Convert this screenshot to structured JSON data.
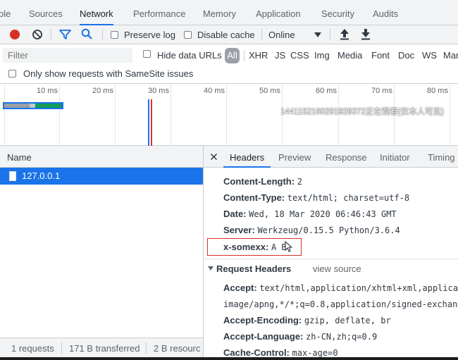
{
  "tabs": [
    {
      "label": "ble"
    },
    {
      "label": "Sources"
    },
    {
      "label": "Network"
    },
    {
      "label": "Performance"
    },
    {
      "label": "Memory"
    },
    {
      "label": "Application"
    },
    {
      "label": "Security"
    },
    {
      "label": "Audits"
    }
  ],
  "toolbar": {
    "preserve_log": "Preserve log",
    "disable_cache": "Disable cache",
    "throttle": "Online"
  },
  "filter": {
    "placeholder": "Filter",
    "hide_data_urls": "Hide data URLs",
    "types": [
      "All",
      "XHR",
      "JS",
      "CSS",
      "Img",
      "Media",
      "Font",
      "Doc",
      "WS",
      "Mar"
    ]
  },
  "samesite": "Only show requests with SameSite issues",
  "timeline": {
    "ticks": [
      "10 ms",
      "20 ms",
      "30 ms",
      "40 ms",
      "50 ms",
      "60 ms",
      "70 ms",
      "80 ms"
    ],
    "watermark": "1441152160291928372正在观看(仅本人可见)"
  },
  "colors": {
    "accent": "#1a73e8",
    "record": "#d93025",
    "highlight": "#d93025"
  },
  "requests": {
    "column_name": "Name",
    "rows": [
      {
        "name": "127.0.0.1"
      }
    ]
  },
  "status": {
    "requests": "1 requests",
    "transferred": "171 B transferred",
    "resources": "2 B resourc"
  },
  "detail_tabs": [
    "Headers",
    "Preview",
    "Response",
    "Initiator",
    "Timing"
  ],
  "response_headers": [
    {
      "name": "Content-Length:",
      "value": "2"
    },
    {
      "name": "Content-Type:",
      "value": "text/html; charset=utf-8"
    },
    {
      "name": "Date:",
      "value": "Wed, 18 Mar 2020 06:46:43 GMT"
    },
    {
      "name": "Server:",
      "value": "Werkzeug/0.15.5 Python/3.6.4"
    },
    {
      "name": "x-somexx:",
      "value": "A B"
    }
  ],
  "request_headers": {
    "title": "Request Headers",
    "view_source": "view source",
    "items": [
      {
        "name": "Accept:",
        "value": "text/html,application/xhtml+xml,applica"
      },
      {
        "name": "",
        "value": "image/apng,*/*;q=0.8,application/signed-exchan"
      },
      {
        "name": "Accept-Encoding:",
        "value": "gzip, deflate, br"
      },
      {
        "name": "Accept-Language:",
        "value": "zh-CN,zh;q=0.9"
      },
      {
        "name": "Cache-Control:",
        "value": "max-age=0"
      }
    ]
  }
}
